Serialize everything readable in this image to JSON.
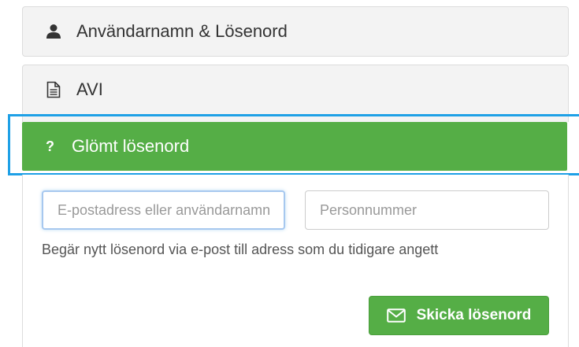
{
  "accordion": {
    "user_pass": {
      "label": "Användarnamn & Lösenord",
      "icon": "user-icon"
    },
    "avi": {
      "label": "AVI",
      "icon": "document-icon"
    },
    "forgot": {
      "label": "Glömt lösenord",
      "icon": "question-icon",
      "icon_glyph": "?"
    }
  },
  "form": {
    "email_placeholder": "E-postadress eller användarnamn",
    "pnr_placeholder": "Personnummer",
    "help_text": "Begär nytt lösenord via e-post till adress som du tidigare angett",
    "submit_label": "Skicka lösenord",
    "submit_icon": "envelope-icon"
  },
  "colors": {
    "accent_green": "#55ae46",
    "focus_blue": "#1ea0e6"
  }
}
